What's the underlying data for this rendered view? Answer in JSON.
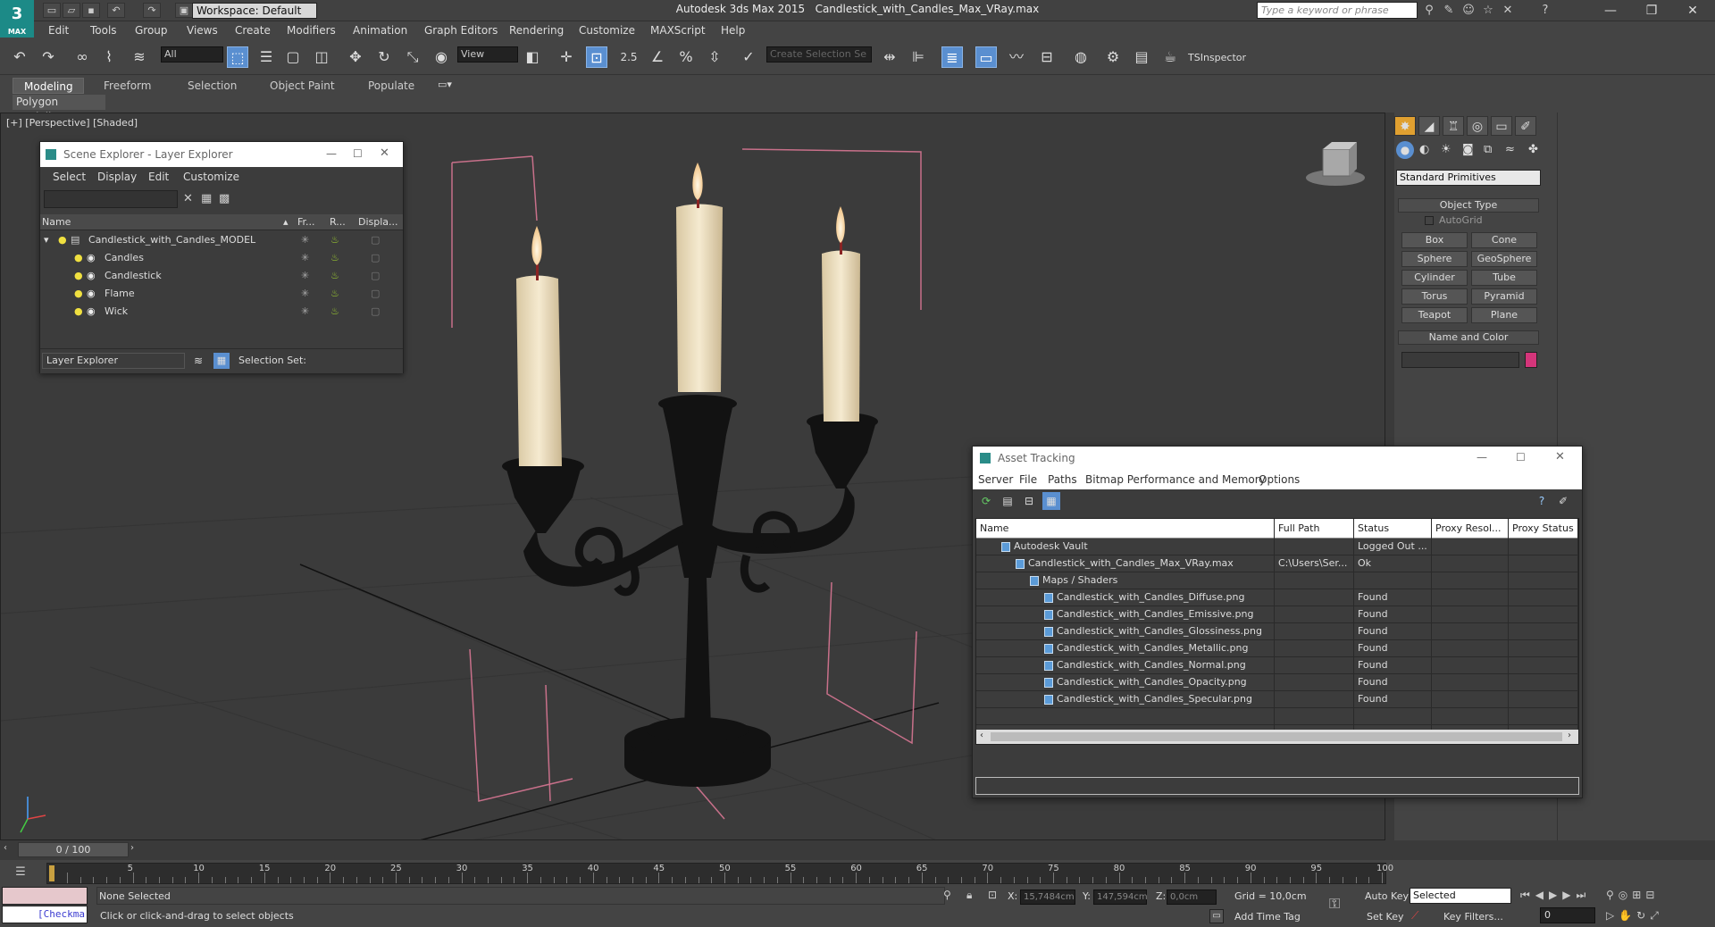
{
  "app": {
    "title": "Autodesk 3ds Max 2015",
    "file": "Candlestick_with_Candles_Max_VRay.max",
    "logo_text": "MAX",
    "workspace": "Workspace: Default",
    "search_placeholder": "Type a keyword or phrase"
  },
  "menu": [
    "Edit",
    "Tools",
    "Group",
    "Views",
    "Create",
    "Modifiers",
    "Animation",
    "Graph Editors",
    "Rendering",
    "Customize",
    "MAXScript",
    "Help"
  ],
  "toolbar": {
    "filter": "All",
    "refcoord": "View",
    "snap_label": "2.5",
    "selection_set_placeholder": "Create Selection Se",
    "tsinspector": "TSInspector"
  },
  "ribbon": {
    "tabs": [
      "Modeling",
      "Freeform",
      "Selection",
      "Object Paint",
      "Populate"
    ],
    "sub": "Polygon Modeling"
  },
  "viewport": {
    "label": "[+] [Perspective] [Shaded]"
  },
  "scene_explorer": {
    "title": "Scene Explorer - Layer Explorer",
    "menu": [
      "Select",
      "Display",
      "Edit",
      "Customize"
    ],
    "columns": [
      "Name",
      "Fr...",
      "R...",
      "Displa..."
    ],
    "root": "Candlestick_with_Candles_MODEL",
    "layers": [
      "Candles",
      "Candlestick",
      "Flame",
      "Wick"
    ],
    "footer_dropdown": "Layer Explorer",
    "selection_set": "Selection Set:"
  },
  "command_panel": {
    "category": "Standard Primitives",
    "object_type": "Object Type",
    "autogrid": "AutoGrid",
    "buttons": [
      "Box",
      "Cone",
      "Sphere",
      "GeoSphere",
      "Cylinder",
      "Tube",
      "Torus",
      "Pyramid",
      "Teapot",
      "Plane"
    ],
    "name_color": "Name and Color",
    "swatch_color": "#d4357a"
  },
  "asset_tracking": {
    "title": "Asset Tracking",
    "menu": [
      "Server",
      "File",
      "Paths",
      "Bitmap Performance and Memory",
      "Options"
    ],
    "columns": [
      "Name",
      "Full Path",
      "Status",
      "Proxy Resol...",
      "Proxy Status"
    ],
    "rows": [
      {
        "name": "Autodesk Vault",
        "path": "",
        "status": "Logged Out ...",
        "indent": 1
      },
      {
        "name": "Candlestick_with_Candles_Max_VRay.max",
        "path": "C:\\Users\\Ser...",
        "status": "Ok",
        "indent": 2
      },
      {
        "name": "Maps / Shaders",
        "path": "",
        "status": "",
        "indent": 3
      },
      {
        "name": "Candlestick_with_Candles_Diffuse.png",
        "path": "",
        "status": "Found",
        "indent": 4
      },
      {
        "name": "Candlestick_with_Candles_Emissive.png",
        "path": "",
        "status": "Found",
        "indent": 4
      },
      {
        "name": "Candlestick_with_Candles_Glossiness.png",
        "path": "",
        "status": "Found",
        "indent": 4
      },
      {
        "name": "Candlestick_with_Candles_Metallic.png",
        "path": "",
        "status": "Found",
        "indent": 4
      },
      {
        "name": "Candlestick_with_Candles_Normal.png",
        "path": "",
        "status": "Found",
        "indent": 4
      },
      {
        "name": "Candlestick_with_Candles_Opacity.png",
        "path": "",
        "status": "Found",
        "indent": 4
      },
      {
        "name": "Candlestick_with_Candles_Specular.png",
        "path": "",
        "status": "Found",
        "indent": 4
      }
    ]
  },
  "timeline": {
    "frame": "0 / 100",
    "ticks": [
      "5",
      "10",
      "15",
      "20",
      "25",
      "30",
      "35",
      "40",
      "45",
      "50",
      "55",
      "60",
      "65",
      "70",
      "75",
      "80",
      "85",
      "90",
      "95",
      "100"
    ]
  },
  "status": {
    "maxscript": "[Checkma",
    "selected": "None Selected",
    "prompt": "Click or click-and-drag to select objects",
    "x_label": "X:",
    "x": "15,7484cm",
    "y_label": "Y:",
    "y": "147,594cm",
    "z_label": "Z:",
    "z": "0,0cm",
    "grid": "Grid = 10,0cm",
    "add_time_tag": "Add Time Tag",
    "auto_key": "Auto Key",
    "key_mode": "Selected",
    "set_key": "Set Key",
    "key_filters": "Key Filters...",
    "frame_value": "0"
  }
}
